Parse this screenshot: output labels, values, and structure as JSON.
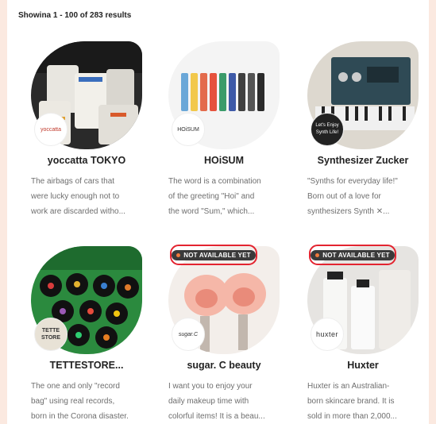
{
  "results": {
    "label": "Showina 1 - 100 of 283 results"
  },
  "badge_label": "NOT AVAILABLE YET",
  "cards": [
    {
      "title": "yoccatta TOKYO",
      "logo": "yoccatta",
      "desc": [
        "The airbags of cars that",
        "were lucky enough not to",
        "work are discarded witho..."
      ]
    },
    {
      "title": "HOiSUM",
      "logo": "HOiSUM",
      "desc": [
        "The word is a combination",
        "of the greeting \"Hoi\" and",
        "the word \"Sum,\" which..."
      ]
    },
    {
      "title": "Synthesizer Zucker",
      "logo": "Let's Enjoy Synth Life!",
      "desc": [
        "\"Synths for everyday life!\"",
        "Born out of a love for",
        "synthesizers Synth ✕..."
      ]
    },
    {
      "title": "TETTESTORE...",
      "logo": "TETTE STORE",
      "desc": [
        "The one and only \"record",
        "bag\" using real records,",
        "born in the Corona disaster."
      ]
    },
    {
      "title": "sugar. C beauty",
      "logo": "sugar.C",
      "desc": [
        "I want you to enjoy your",
        "daily makeup time with",
        "colorful items! It is a beau..."
      ]
    },
    {
      "title": "Huxter",
      "logo": "huxter",
      "desc": [
        "Huxter is an Australian-",
        "born skincare brand. It is",
        "sold in more than 2,000..."
      ]
    }
  ]
}
